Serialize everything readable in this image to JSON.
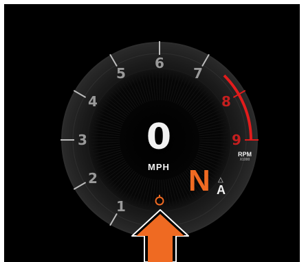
{
  "cluster": {
    "speed": {
      "value": "0",
      "unit": "MPH"
    },
    "tachometer": {
      "unit": "RPM",
      "multiplier": "X1000",
      "redline_from": 7.5,
      "needle_value": 0,
      "ticks": [
        {
          "label": "1",
          "value": 1
        },
        {
          "label": "2",
          "value": 2
        },
        {
          "label": "3",
          "value": 3
        },
        {
          "label": "4",
          "value": 4
        },
        {
          "label": "5",
          "value": 5
        },
        {
          "label": "6",
          "value": 6
        },
        {
          "label": "7",
          "value": 7
        },
        {
          "label": "8",
          "value": 8
        },
        {
          "label": "9",
          "value": 9
        }
      ]
    },
    "gear": {
      "value": "N",
      "mode_indicator": "△",
      "mode": "A"
    },
    "indicators": [
      {
        "name": "lap-timer-icon"
      }
    ],
    "colors": {
      "screen_background": "#000000",
      "gauge_bezel": "#1e1e1e",
      "tick_label": "#9a9a9a",
      "redline": "#e21c1c",
      "redline_label": "#c51f1f",
      "gear_accent": "#ef6a22",
      "arrow": "#ef6a22",
      "text_primary": "#f2f2f2"
    }
  },
  "overlay": {
    "pointer_arrow": {
      "direction": "up",
      "color": "#ef6a22"
    }
  }
}
